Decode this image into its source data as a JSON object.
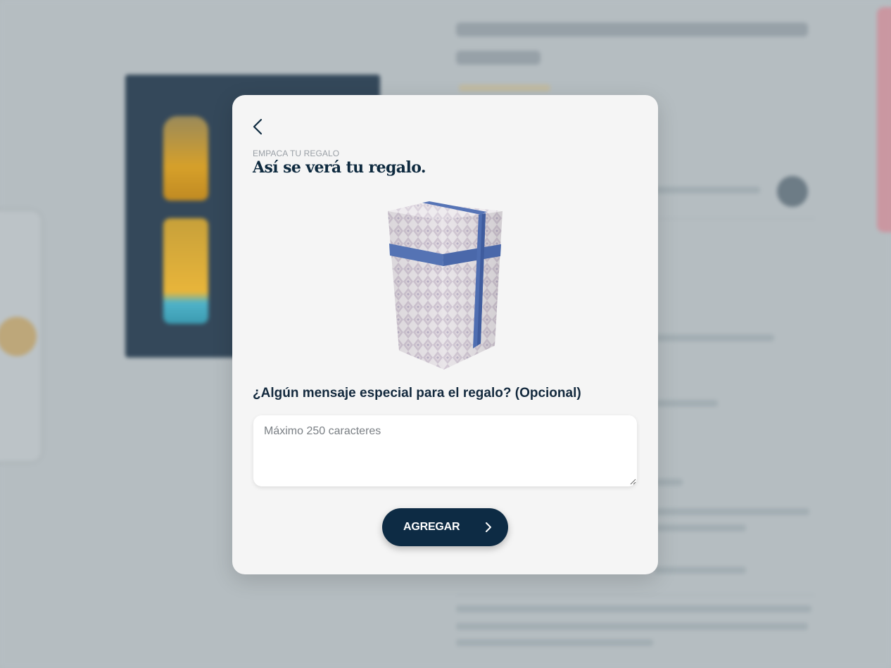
{
  "modal": {
    "eyebrow": "EMPACA TU REGALO",
    "title": "Así se verá tu regalo.",
    "question": "¿Algún mensaje especial para el regalo? (Opcional)",
    "message_placeholder": "Máximo 250 caracteres",
    "message_value": "",
    "add_label": "AGREGAR"
  },
  "icons": {
    "back": "chevron-left-icon",
    "add": "chevron-right-icon"
  },
  "colors": {
    "primary": "#0d2b44",
    "modal_bg": "#f5f5f5",
    "ribbon": "#4f6fb0",
    "overlay": "#b4bcc0"
  }
}
